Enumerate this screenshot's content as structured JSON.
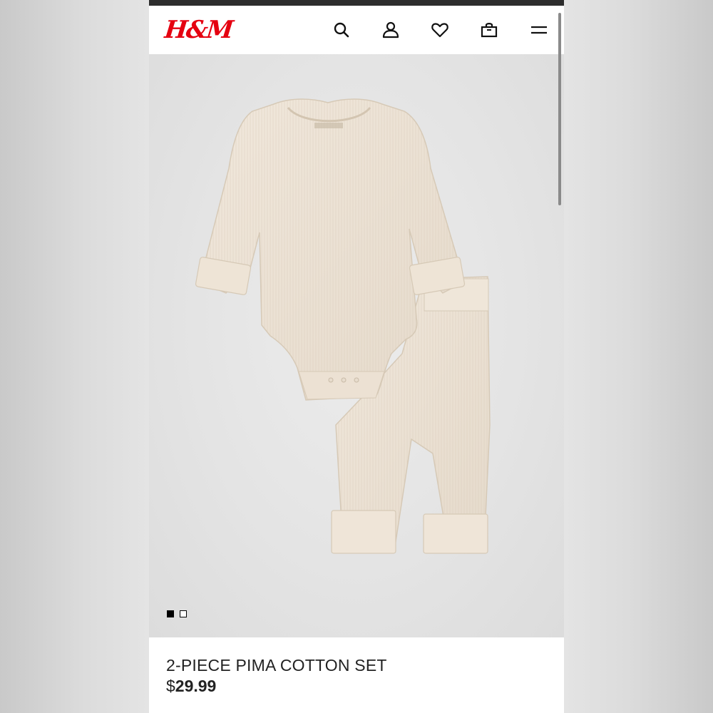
{
  "header": {
    "logo_text": "H&M",
    "brand_color": "#e50010",
    "icons": [
      "search-icon",
      "account-icon",
      "heart-icon",
      "bag-icon",
      "menu-icon"
    ]
  },
  "gallery": {
    "image_count": 2,
    "active_index": 0
  },
  "product": {
    "title": "2-PIECE PIMA COTTON SET",
    "price_currency": "$",
    "price_amount": "29.99"
  },
  "colors": {
    "garment": "#ece2d4",
    "background": "#e4e4e4"
  }
}
